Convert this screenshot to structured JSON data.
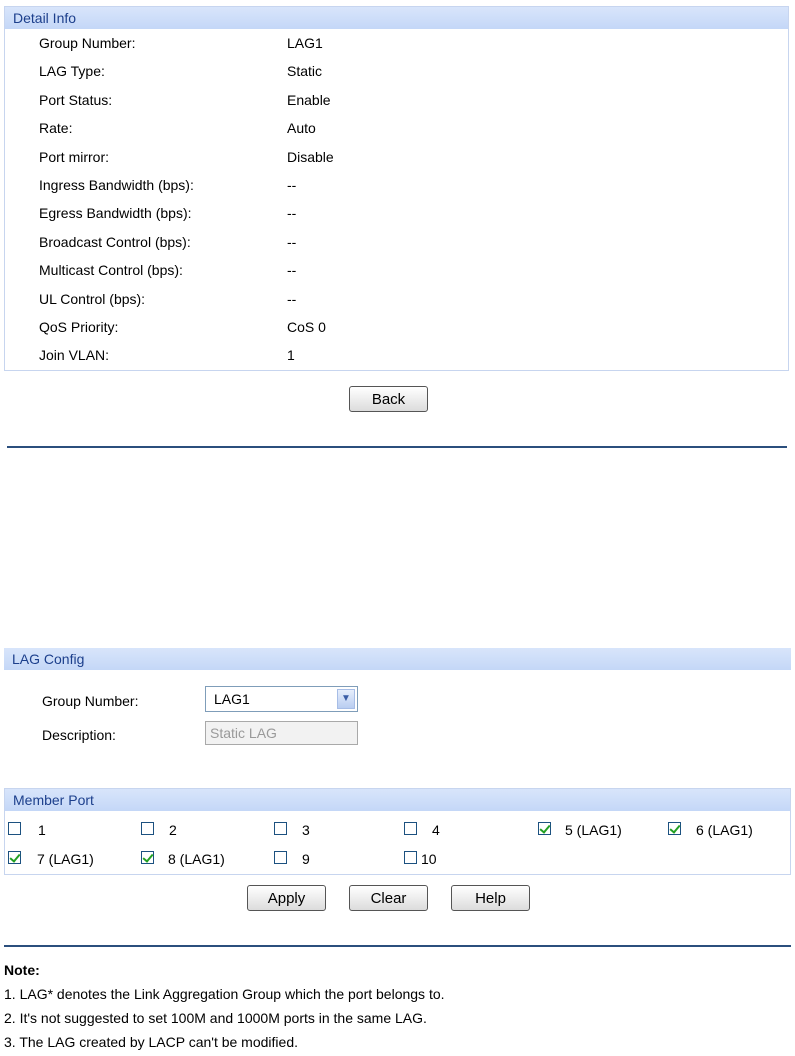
{
  "detail": {
    "header": "Detail Info",
    "rows": [
      {
        "label": "Group Number:",
        "value": "LAG1"
      },
      {
        "label": "LAG Type:",
        "value": "Static"
      },
      {
        "label": "Port Status:",
        "value": "Enable"
      },
      {
        "label": "Rate:",
        "value": "Auto"
      },
      {
        "label": "Port mirror:",
        "value": "Disable"
      },
      {
        "label": "Ingress Bandwidth (bps):",
        "value": "--"
      },
      {
        "label": "Egress Bandwidth (bps):",
        "value": "--"
      },
      {
        "label": "Broadcast Control (bps):",
        "value": "--"
      },
      {
        "label": "Multicast Control (bps):",
        "value": "--"
      },
      {
        "label": "UL Control (bps):",
        "value": "--"
      },
      {
        "label": "QoS Priority:",
        "value": "CoS 0"
      },
      {
        "label": "Join VLAN:",
        "value": "1"
      }
    ],
    "back_label": "Back"
  },
  "lag_config": {
    "header": "LAG Config",
    "group_number_label": "Group Number:",
    "group_number_value": "LAG1",
    "description_label": "Description:",
    "description_value": "Static LAG"
  },
  "member_port": {
    "header": "Member Port",
    "ports": [
      {
        "label": "1",
        "checked": false
      },
      {
        "label": "2",
        "checked": false
      },
      {
        "label": "3",
        "checked": false
      },
      {
        "label": "4",
        "checked": false
      },
      {
        "label": "5 (LAG1)",
        "checked": true
      },
      {
        "label": "6 (LAG1)",
        "checked": true
      },
      {
        "label": "7 (LAG1)",
        "checked": true
      },
      {
        "label": "8 (LAG1)",
        "checked": true
      },
      {
        "label": "9",
        "checked": false
      },
      {
        "label": "10",
        "checked": false
      }
    ]
  },
  "actions": {
    "apply_label": "Apply",
    "clear_label": "Clear",
    "help_label": "Help"
  },
  "note": {
    "title": "Note:",
    "lines": [
      "1. LAG* denotes the Link Aggregation Group which the port belongs to.",
      "2. It's not suggested to set 100M and 1000M ports in the same LAG.",
      "3. The LAG created by LACP can't be modified."
    ]
  }
}
